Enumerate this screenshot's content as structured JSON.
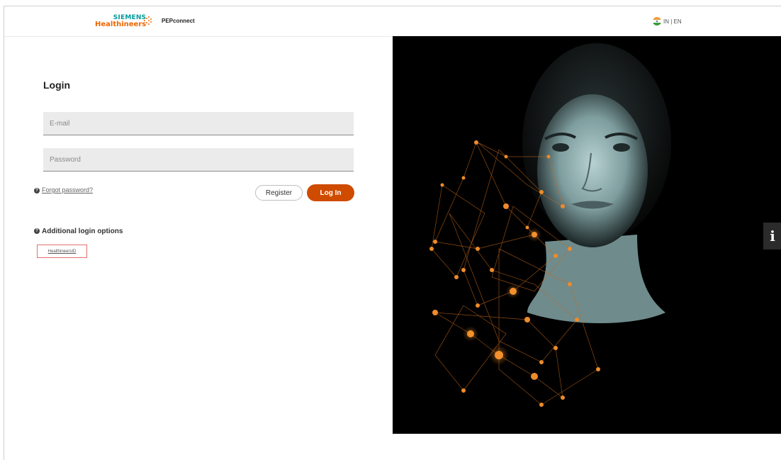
{
  "header": {
    "brand_line1": "SIEMENS",
    "brand_line2": "Healthineers",
    "product": "PEPconnect",
    "locale": "IN | EN",
    "brand_color": "#ec6602",
    "teal_color": "#009999"
  },
  "login": {
    "title": "Login",
    "email_placeholder": "E-mail",
    "password_placeholder": "Password",
    "forgot_label": "Forgot password?",
    "register_label": "Register",
    "login_label": "Log In",
    "accent_color": "#cf4b00"
  },
  "additional": {
    "title": "Additional login options",
    "options": [
      "HealthineersID"
    ]
  },
  "hero": {
    "icon": "portrait-network-image"
  },
  "info_tab": {
    "label": "i"
  }
}
